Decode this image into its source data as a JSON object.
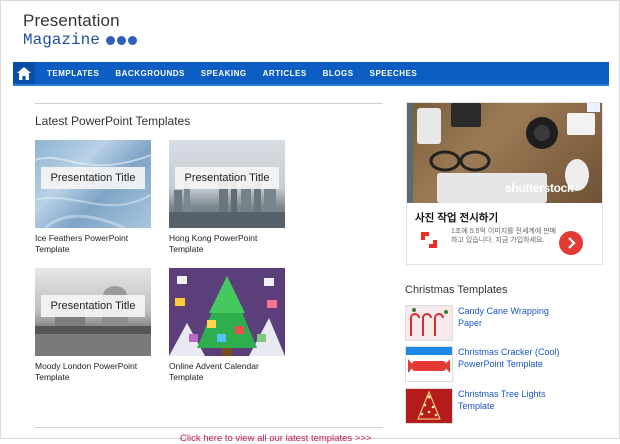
{
  "logo": {
    "line1": "Presentation",
    "line2": "Magazine"
  },
  "nav": {
    "home_icon": "home-icon",
    "items": [
      "TEMPLATES",
      "BACKGROUNDS",
      "SPEAKING",
      "ARTICLES",
      "BLOGS",
      "SPEECHES"
    ]
  },
  "latest": {
    "title": "Latest PowerPoint Templates",
    "cards": [
      {
        "overlay": "Presentation Title",
        "caption": "Ice Feathers PowerPoint Template"
      },
      {
        "overlay": "Presentation Title",
        "caption": "Hong Kong PowerPoint Template"
      },
      {
        "overlay": "Presentation Title",
        "caption": "Moody London PowerPoint Template"
      },
      {
        "overlay": "",
        "caption": "Online Advent Calendar Template"
      }
    ],
    "view_all": "Click here to view all our latest templates >>>"
  },
  "ad": {
    "brand": "shutterstock",
    "title": "사진 작업 전시하기",
    "desc": "1조에 5.5억 이미지를 전세계에 판매하고 있습니다. 지금 가입하세요."
  },
  "christmas": {
    "title": "Christmas Templates",
    "items": [
      {
        "label": "Candy Cane Wrapping Paper"
      },
      {
        "label": "Christmas Cracker (Cool) PowerPoint Template"
      },
      {
        "label": "Christmas Tree Lights Template"
      }
    ]
  },
  "colors": {
    "nav": "#0b5dc4",
    "link": "#1a56c8",
    "view_all": "#c2185b"
  }
}
